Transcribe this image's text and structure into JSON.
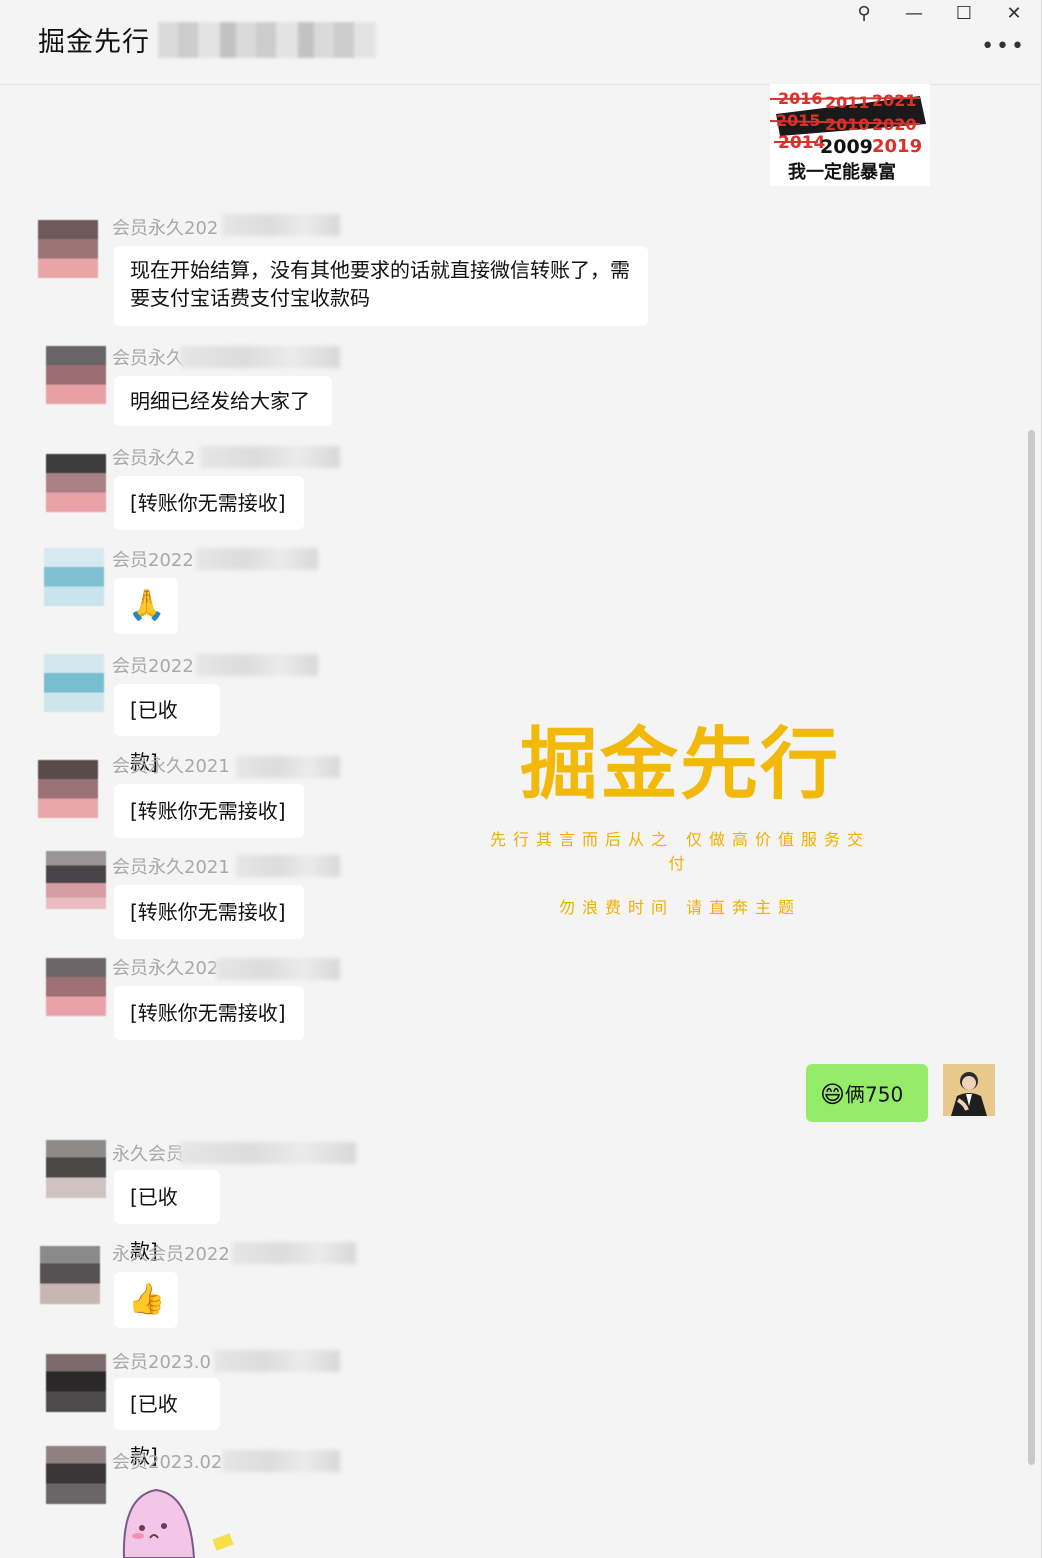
{
  "window": {
    "title": "掘金先行",
    "controls": {
      "pin": "⚲",
      "minimize": "—",
      "maximize": "☐",
      "close": "✕",
      "more": "•••"
    }
  },
  "sticker_top": {
    "years_crossed": [
      "2016",
      "2011",
      "2021",
      "2015",
      "2010",
      "2020",
      "2014"
    ],
    "years_plain": [
      "2009",
      "2019"
    ],
    "caption": "我一定能暴富"
  },
  "watermark": {
    "title": "掘金先行",
    "line1": "先行其言而后从之 仅做高价值服务交付",
    "line2": "勿浪费时间 请直奔主题"
  },
  "messages": [
    {
      "nick": "会员永久202",
      "text": "现在开始结算，没有其他要求的话就直接微信转账了，需要支付宝话费支付宝收款码"
    },
    {
      "nick": "会员永久",
      "text": "明细已经发给大家了"
    },
    {
      "nick": "会员永久2",
      "text": "[转账你无需接收]"
    },
    {
      "nick": "会员2022",
      "text": "🙏"
    },
    {
      "nick": "会员2022",
      "text": "[已收款]"
    },
    {
      "nick": "会员永久2021",
      "text": "[转账你无需接收]"
    },
    {
      "nick": "会员永久2021",
      "text": "[转账你无需接收]"
    },
    {
      "nick": "会员永久202",
      "text": "[转账你无需接收]"
    },
    {
      "nick": "永久会员",
      "text": "[已收款]"
    },
    {
      "nick": "永久会员2022",
      "text": "👍"
    },
    {
      "nick": "会员2023.0",
      "text": "[已收款]"
    },
    {
      "nick": "会员2023.02",
      "text": ""
    }
  ],
  "self_message": {
    "emoji": "😄",
    "text": "俩750"
  },
  "colors": {
    "self_bubble": "#95ec69",
    "watermark": "#f3b90a",
    "nick": "#a8a8a8"
  }
}
